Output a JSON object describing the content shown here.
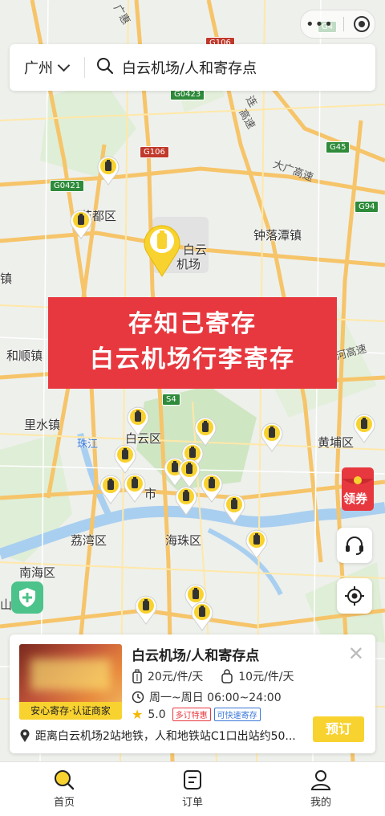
{
  "search": {
    "city": "广州",
    "query": "白云机场/人和寄存点"
  },
  "banner": {
    "line1": "存知己寄存",
    "line2": "白云机场行李寄存"
  },
  "map_labels": {
    "huadu": "花都区",
    "baiyun_airport_a": "白云",
    "baiyun_airport_b": "机场",
    "zhongluotan": "钟落潭镇",
    "heshun": "和顺镇",
    "lishui": "里水镇",
    "baiyunqu": "白云区",
    "huangpu": "黄埔区",
    "liwan": "荔湾区",
    "haizhu": "海珠区",
    "nanhai": "南海区",
    "zhujiang": "珠江",
    "shi": "市",
    "daguang": "大广高速",
    "hegao": "河高速",
    "liangao_a": "连",
    "liangao_b": "高速",
    "jingzhu": "广惠",
    "left_zhen": "镇",
    "left_shan": "山"
  },
  "shields": {
    "g106_top": "G106",
    "g4": "G4",
    "g0423": "G0423",
    "g106": "G106",
    "g45": "G45",
    "g0421": "G0421",
    "g94": "G94",
    "s4": "S4"
  },
  "coupon_label": "领券",
  "card": {
    "title": "白云机场/人和寄存点",
    "cert_label": "安心寄存·认证商家",
    "price_box": "20元/件/天",
    "price_bag": "10元/件/天",
    "hours": "周一~周日 06:00~24:00",
    "rating": "5.0",
    "tag_discount": "多订特惠",
    "tag_express": "可快速寄存",
    "distance": "距离白云机场2站地铁，人和地铁站C1口出站约50...",
    "book_label": "预订"
  },
  "tabs": [
    {
      "label": "首页"
    },
    {
      "label": "订单"
    },
    {
      "label": "我的"
    }
  ],
  "colors": {
    "accent_yellow": "#f8d22f",
    "banner_red": "#e8383f",
    "shield_green": "#4cc38a"
  }
}
